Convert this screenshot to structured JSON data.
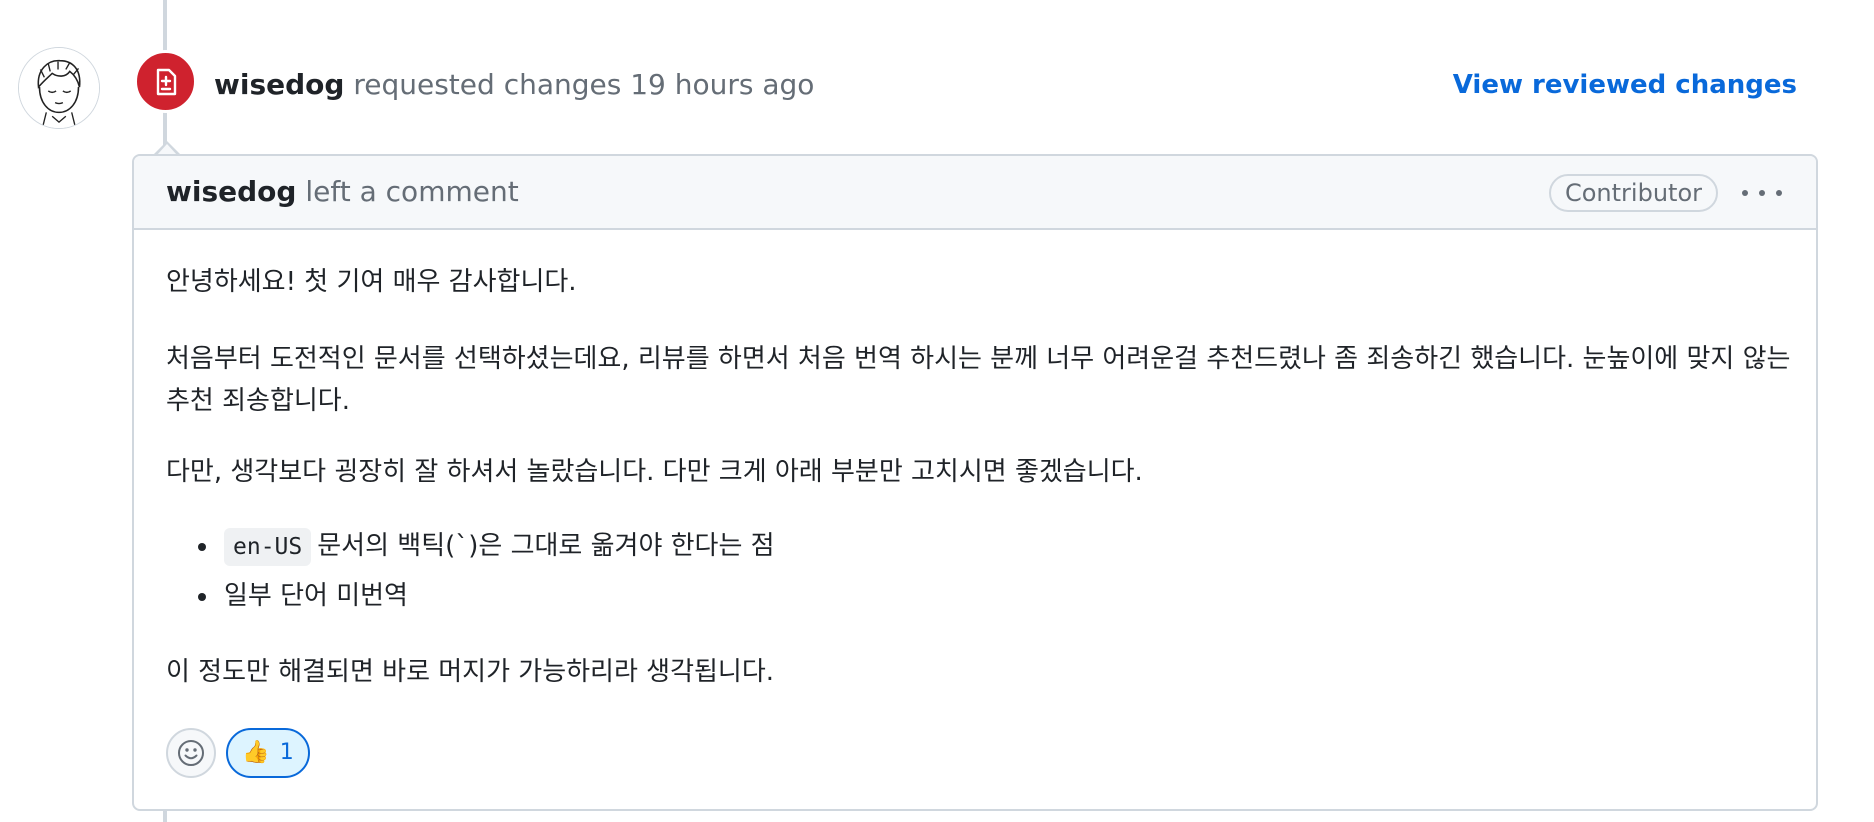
{
  "review": {
    "author": "wisedog",
    "action": " requested changes 19 hours ago",
    "view_changes_label": "View reviewed changes",
    "badge_icon": "file-diff-icon",
    "badge_color": "#cf222e"
  },
  "comment": {
    "author": "wisedog",
    "action": " left a comment",
    "role_badge": "Contributor",
    "menu_icon": "kebab-horizontal-icon",
    "paragraphs": [
      "안녕하세요! 첫 기여 매우 감사합니다.",
      "처음부터 도전적인 문서를 선택하셨는데요, 리뷰를 하면서 처음 번역 하시는 분께 너무 어려운걸 추천드렸나 좀 죄송하긴 했습니다. 눈높이에 맞지 않는 추천 죄송합니다.",
      "다만, 생각보다 굉장히 잘 하셔서 놀랐습니다. 다만 크게 아래 부분만 고치시면 좋겠습니다.",
      "이 정도만 해결되면 바로 머지가 가능하리라 생각됩니다."
    ],
    "bullets": [
      {
        "code": "en-US",
        "text": "문서의 백틱(`)은 그대로 옮겨야 한다는 점"
      },
      {
        "code": "",
        "text": "일부 단어 미번역"
      }
    ]
  },
  "reactions": {
    "add_icon": "smiley-icon",
    "thumbs_emoji": "👍",
    "thumbs_count": "1",
    "accent": "#0969da"
  }
}
